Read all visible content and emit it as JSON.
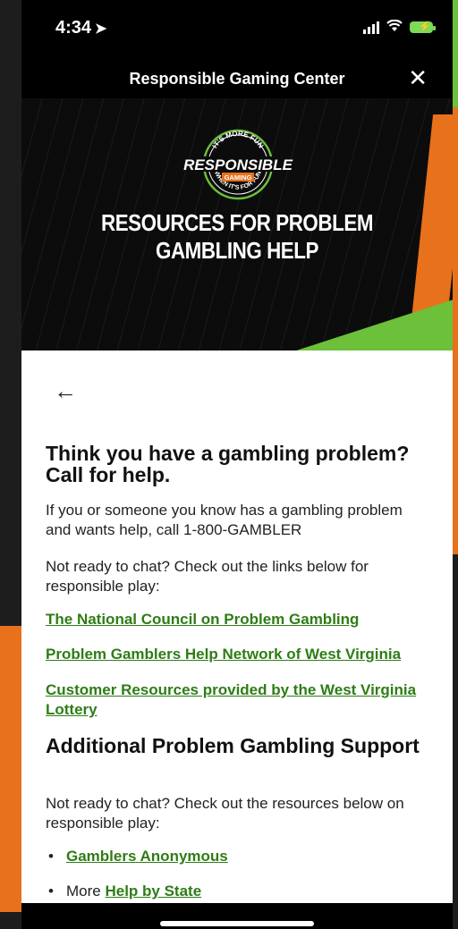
{
  "status_bar": {
    "time": "4:34"
  },
  "header": {
    "title": "Responsible Gaming Center",
    "close_icon": "close-icon"
  },
  "banner": {
    "badge_top": "IT'S MORE FUN",
    "badge_main": "RESPONSIBLE",
    "badge_sub": "GAMING",
    "badge_bottom": "WHEN IT'S FOR FUN",
    "heading": "RESOURCES FOR PROBLEM GAMBLING HELP"
  },
  "content": {
    "heading_1": "Think you have a gambling problem? Call for help.",
    "para_1": "If you or someone you know has a gambling problem and wants help, call 1-800-GAMBLER",
    "para_2": "Not ready to chat? Check out the links below for responsible play:",
    "links": [
      "The National Council on Problem Gambling",
      "Problem Gamblers Help Network of West Virginia",
      "Customer Resources provided by the West Virginia Lottery"
    ],
    "heading_2": "Additional Problem Gambling Support",
    "para_3": "Not ready to chat? Check out the resources below on responsible play:",
    "bullets": [
      {
        "prefix": "",
        "link": "Gamblers Anonymous"
      },
      {
        "prefix": "More ",
        "link": "Help by State"
      }
    ]
  },
  "colors": {
    "link": "#2e7d16",
    "accent_green": "#6cc03a",
    "accent_orange": "#e8711c"
  }
}
